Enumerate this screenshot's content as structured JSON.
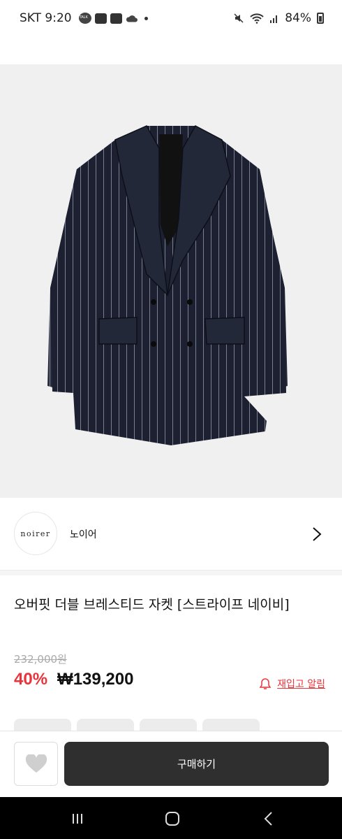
{
  "status_bar": {
    "carrier_time": "SKT 9:20",
    "talk_icon_text": "TALK",
    "battery": "84%"
  },
  "product_image": {
    "alt": "Navy pinstripe double-breasted jacket"
  },
  "brand": {
    "logo_text": "noirer",
    "name": "노이어"
  },
  "product": {
    "title": "오버핏 더블 브레스티드 자켓 [스트라이프 네이비]",
    "original_price": "232,000원",
    "discount": "40%",
    "sale_price": "₩139,200"
  },
  "restock": {
    "label": "재입고 알림"
  },
  "bottom_bar": {
    "buy_label": "구매하기"
  },
  "colors": {
    "accent_red": "#e8343a",
    "buy_button": "#2f2f2f"
  }
}
